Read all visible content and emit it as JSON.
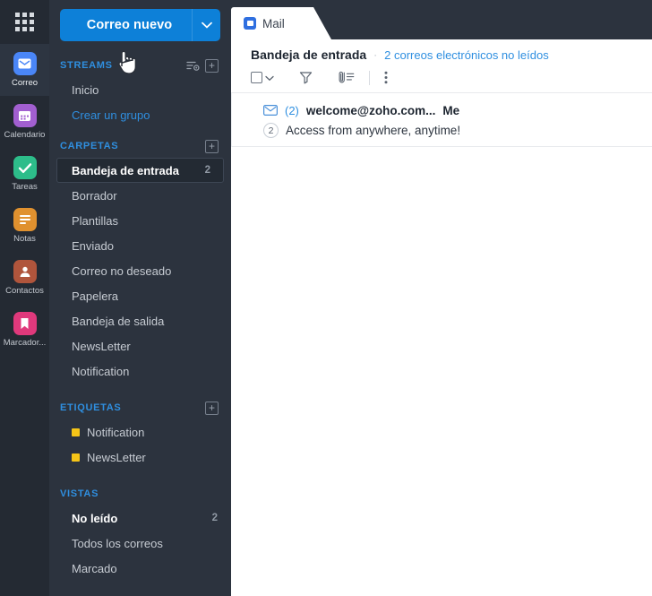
{
  "colors": {
    "rail_bg": "#242a33",
    "sidebar_bg": "#2c333e",
    "accent_blue": "#2f8fe0",
    "compose_blue": "#0d80d8",
    "label_yellow": "#f5c518"
  },
  "rail": {
    "launcher_icon": "apps-grid-icon",
    "items": [
      {
        "label": "Correo",
        "icon": "mail-icon",
        "color": "#4a86f7",
        "active": true
      },
      {
        "label": "Calendario",
        "icon": "calendar-icon",
        "color": "#a25fd0",
        "active": false
      },
      {
        "label": "Tareas",
        "icon": "check-icon",
        "color": "#2dbd8a",
        "active": false
      },
      {
        "label": "Notas",
        "icon": "notes-icon",
        "color": "#e0912f",
        "active": false
      },
      {
        "label": "Contactos",
        "icon": "person-icon",
        "color": "#b0553c",
        "active": false
      },
      {
        "label": "Marcador...",
        "icon": "bookmark-icon",
        "color": "#e0397c",
        "active": false
      }
    ]
  },
  "sidebar": {
    "compose": {
      "label": "Correo nuevo",
      "caret_icon": "chevron-down-icon"
    },
    "sections": [
      {
        "key": "streams",
        "title": "STREAMS",
        "actions": [
          {
            "icon": "stream-settings-icon"
          },
          {
            "icon": "plus-box-icon"
          }
        ],
        "items": [
          {
            "label": "Inicio",
            "count": "",
            "style": "normal"
          },
          {
            "label": "Crear un grupo",
            "count": "",
            "style": "link"
          }
        ]
      },
      {
        "key": "carpetas",
        "title": "CARPETAS",
        "actions": [
          {
            "icon": "plus-box-icon"
          }
        ],
        "items": [
          {
            "label": "Bandeja de entrada",
            "count": "2",
            "style": "active"
          },
          {
            "label": "Borrador",
            "count": "",
            "style": "normal"
          },
          {
            "label": "Plantillas",
            "count": "",
            "style": "normal"
          },
          {
            "label": "Enviado",
            "count": "",
            "style": "normal"
          },
          {
            "label": "Correo no deseado",
            "count": "",
            "style": "normal"
          },
          {
            "label": "Papelera",
            "count": "",
            "style": "normal"
          },
          {
            "label": "Bandeja de salida",
            "count": "",
            "style": "normal"
          },
          {
            "label": "NewsLetter",
            "count": "",
            "style": "normal"
          },
          {
            "label": "Notification",
            "count": "",
            "style": "normal"
          }
        ]
      },
      {
        "key": "etiquetas",
        "title": "ETIQUETAS",
        "actions": [
          {
            "icon": "plus-box-icon"
          }
        ],
        "items": [
          {
            "label": "Notification",
            "count": "",
            "style": "swatch",
            "swatch": "#f5c518"
          },
          {
            "label": "NewsLetter",
            "count": "",
            "style": "swatch",
            "swatch": "#f5c518"
          }
        ]
      },
      {
        "key": "vistas",
        "title": "VISTAS",
        "actions": [],
        "items": [
          {
            "label": "No leído",
            "count": "2",
            "style": "bold"
          },
          {
            "label": "Todos los correos",
            "count": "",
            "style": "normal"
          },
          {
            "label": "Marcado",
            "count": "",
            "style": "normal"
          }
        ]
      }
    ]
  },
  "main": {
    "tab": {
      "label": "Mail",
      "icon": "zoho-mail-tab-icon"
    },
    "breadcrumb": {
      "title": "Bandeja de entrada",
      "separator": "·",
      "unread_link": "2 correos electrónicos no leídos"
    },
    "toolbar": [
      {
        "icon": "select-all-checkbox",
        "label": ""
      },
      {
        "icon": "chevron-down-icon",
        "label": ""
      },
      {
        "icon": "filter-funnel-icon",
        "label": ""
      },
      {
        "icon": "attachment-list-icon",
        "label": ""
      },
      {
        "icon": "more-vertical-icon",
        "label": ""
      }
    ],
    "messages": [
      {
        "envelope_icon": "unread-envelope-icon",
        "thread_count": "(2)",
        "from": "welcome@zoho.com...",
        "to": "Me",
        "badge": "2",
        "subject": "Access from anywhere, anytime!"
      }
    ]
  },
  "cursor": {
    "icon": "pointing-hand-cursor"
  }
}
